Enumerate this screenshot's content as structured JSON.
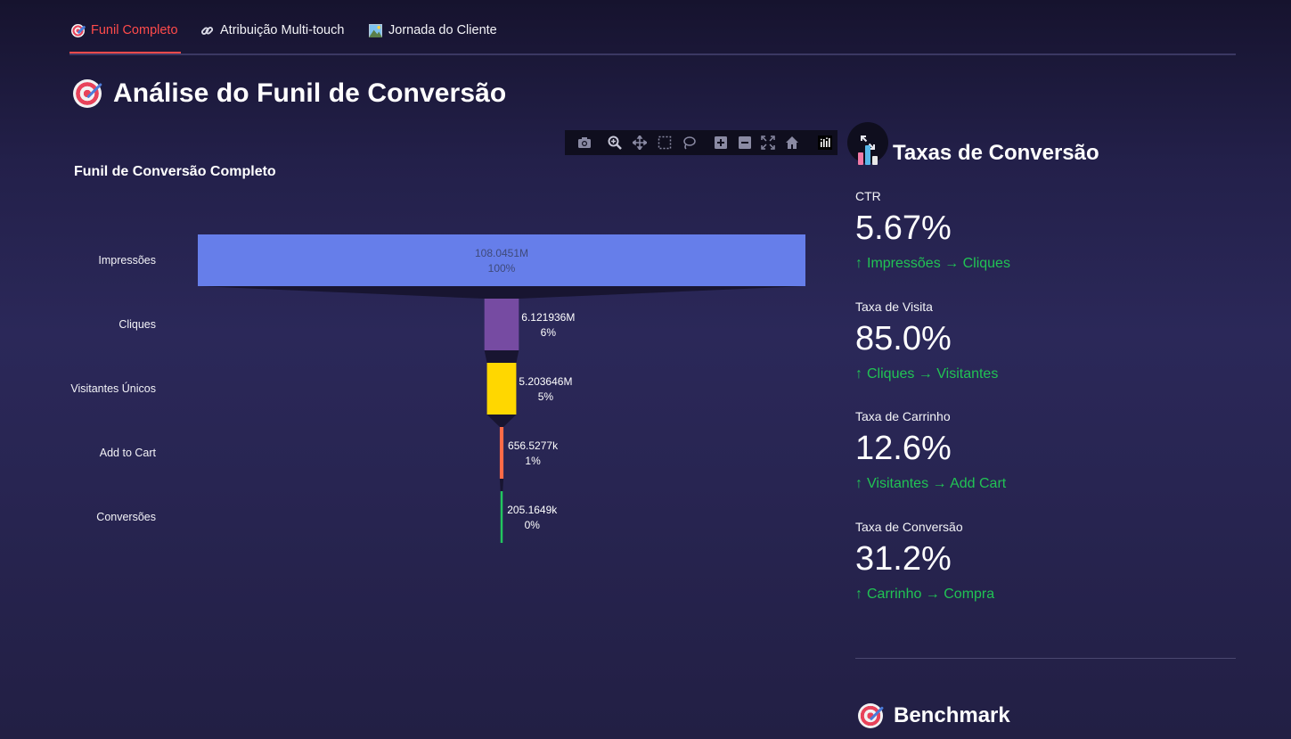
{
  "tabs": [
    {
      "label": "Funil Completo",
      "icon": "target-icon"
    },
    {
      "label": "Atribuição Multi-touch",
      "icon": "link-icon"
    },
    {
      "label": "Jornada do Cliente",
      "icon": "image-icon"
    }
  ],
  "page_title": "Análise do Funil de Conversão",
  "chart_data": {
    "type": "funnel",
    "title": "Funil de Conversão Completo",
    "categories": [
      "Impressões",
      "Cliques",
      "Visitantes Únicos",
      "Add to Cart",
      "Conversões"
    ],
    "values": [
      108045100,
      6121936,
      5203646,
      656527.7,
      205164.9
    ],
    "value_labels": [
      "108.0451M",
      "6.121936M",
      "5.203646M",
      "656.5277k",
      "205.1649k"
    ],
    "percent_labels": [
      "100%",
      "6%",
      "5%",
      "1%",
      "0%"
    ],
    "colors": [
      "#667eea",
      "#764ba2",
      "#ffd700",
      "#ff6b47",
      "#22c55e"
    ]
  },
  "toolbar": {
    "icons": [
      "camera-icon",
      "zoom-icon",
      "pan-icon",
      "box-select-icon",
      "lasso-icon",
      "zoom-in-icon",
      "zoom-out-icon",
      "autoscale-icon",
      "reset-home-icon",
      "plotly-logo-icon"
    ]
  },
  "conversion_section": {
    "title": "Taxas de Conversão",
    "metrics": [
      {
        "label": "CTR",
        "value": "5.67%",
        "delta": "Impressões → Cliques"
      },
      {
        "label": "Taxa de Visita",
        "value": "85.0%",
        "delta": "Cliques → Visitantes"
      },
      {
        "label": "Taxa de Carrinho",
        "value": "12.6%",
        "delta": "Visitantes → Add Cart"
      },
      {
        "label": "Taxa de Conversão",
        "value": "31.2%",
        "delta": "Carrinho → Compra"
      }
    ]
  },
  "benchmark_section": {
    "title": "Benchmark"
  }
}
